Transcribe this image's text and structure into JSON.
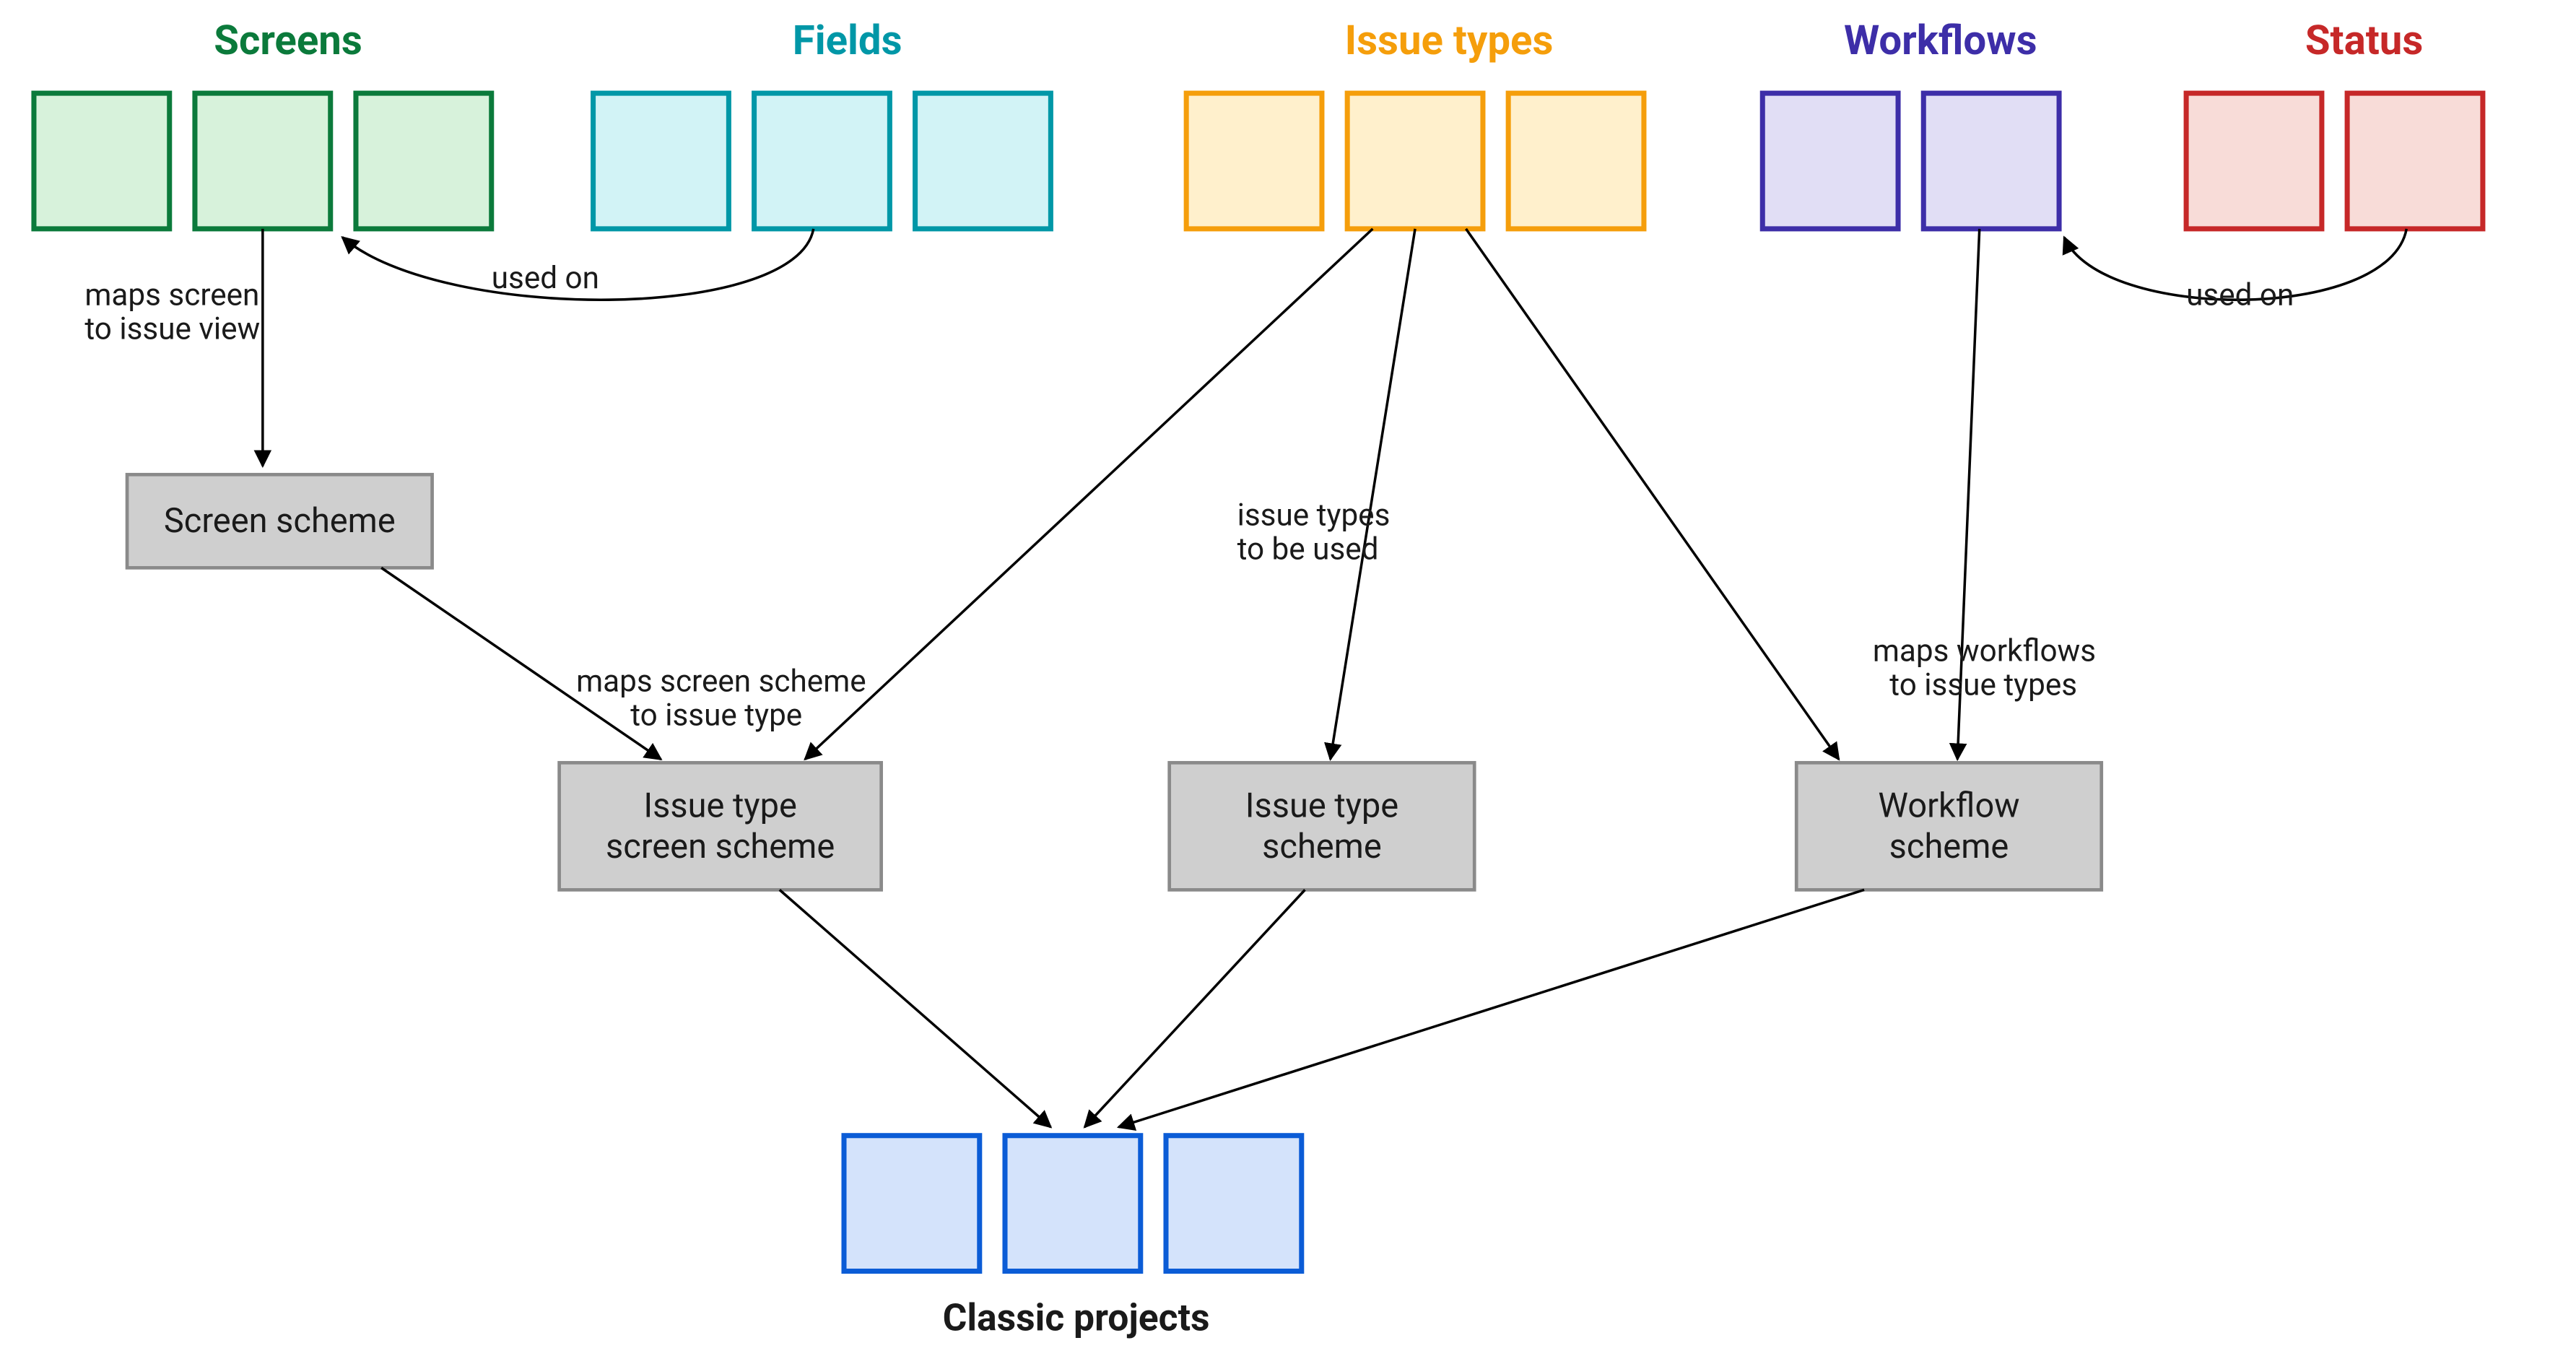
{
  "groups": {
    "screens": {
      "title": "Screens",
      "color": "#0b7a3b",
      "fill": "#d7f2db"
    },
    "fields": {
      "title": "Fields",
      "color": "#0097a7",
      "fill": "#d2f3f6"
    },
    "issuetypes": {
      "title": "Issue types",
      "color": "#f59e0b",
      "fill": "#fff0cc"
    },
    "workflows": {
      "title": "Workflows",
      "color": "#3d2ea8",
      "fill": "#e1def5"
    },
    "status": {
      "title": "Status",
      "color": "#c62828",
      "fill": "#f8dcd8"
    }
  },
  "schemes": {
    "screen": "Screen scheme",
    "itScreenLine1": "Issue type",
    "itScreenLine2": "screen scheme",
    "itLine1": "Issue type",
    "itLine2": "scheme",
    "wfLine1": "Workflow",
    "wfLine2": "scheme"
  },
  "edges": {
    "mapsScreenLine1": "maps screen",
    "mapsScreenLine2": "to issue view",
    "usedOnLeft": "used on",
    "mapsSchemeLine1": "maps screen scheme",
    "mapsSchemeLine2": "to issue type",
    "itToBeUsedLine1": "issue types",
    "itToBeUsedLine2": "to be used",
    "mapsWfLine1": "maps workflows",
    "mapsWfLine2": "to issue types",
    "usedOnRight": "used on"
  },
  "bottom": {
    "label": "Classic projects",
    "color": "#0b5cd6",
    "fill": "#d4e3fb"
  }
}
